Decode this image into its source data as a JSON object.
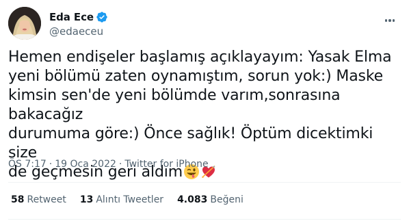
{
  "author": {
    "display_name": "Eda Ece",
    "handle": "@edaeceu",
    "verified": true,
    "avatar_icon": "profile-photo"
  },
  "tweet": {
    "text": "Hemen endişeler başlamış açıklayayım: Yasak Elma\nyeni bölümü zaten oynamıştım, sorun yok:) Maske\nkimsin sen'de yeni bölümde varım,sonrasına bakacağız\ndurumuma göre:) Önce sağlık! Öptüm dicektimki size\nde geçmesin geri aldım",
    "emojis": [
      "winking-face-with-tongue-emoji",
      "heart-with-arrow-emoji"
    ]
  },
  "meta": {
    "time": "ÖS 7:17",
    "date": "19 Oca 2022",
    "source": "Twitter for iPhone",
    "separator": "·"
  },
  "stats": [
    {
      "count": "58",
      "label": "Retweet"
    },
    {
      "count": "13",
      "label": "Alıntı Tweetler"
    },
    {
      "count": "4.083",
      "label": "Beğeni"
    }
  ],
  "colors": {
    "verified_badge": "#1d9bf0",
    "secondary_text": "#536471",
    "primary_text": "#0f1419",
    "divider": "#eff3f4"
  }
}
